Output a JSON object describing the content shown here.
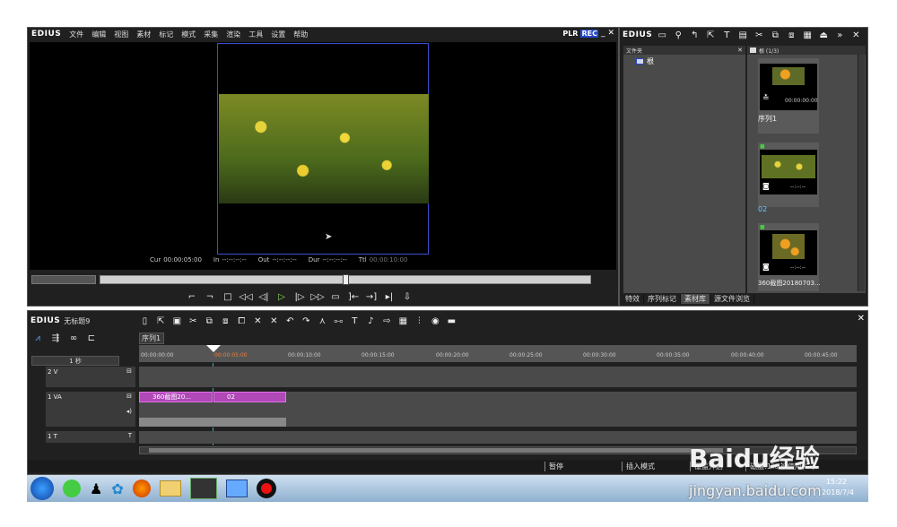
{
  "player": {
    "brand": "EDIUS",
    "menu": [
      "文件",
      "编辑",
      "视图",
      "素材",
      "标记",
      "模式",
      "采集",
      "渲染",
      "工具",
      "设置",
      "帮助"
    ],
    "plr": "PLR",
    "rec": "REC",
    "tc": {
      "cur_label": "Cur",
      "cur": "00:00:05:00",
      "in_label": "In",
      "in": "--:--:--:--",
      "out_label": "Out",
      "out": "--:--:--:--",
      "dur_label": "Dur",
      "dur": "--:--:--:--",
      "ttl_label": "Ttl",
      "ttl": "00:00:10:00"
    }
  },
  "bin": {
    "brand": "EDIUS",
    "folder_header": "文件夹",
    "root_label": "根",
    "clip_header": "根 (1/3)",
    "clips": [
      {
        "label": "序列1",
        "tc": "00:00:00:00"
      },
      {
        "label": "02",
        "tc": "--:--:--"
      },
      {
        "label": "360截图20180703...",
        "tc": "--:--:--"
      }
    ],
    "tabs": [
      "特效",
      "序列标记",
      "素材库",
      "源文件浏览"
    ]
  },
  "timeline": {
    "brand": "EDIUS",
    "project": "无标题9",
    "seq_tab": "序列1",
    "scale": "1 秒",
    "ruler": [
      "00:00:00:00",
      "00:00:05:00",
      "00:00:10:00",
      "00:00:15:00",
      "00:00:20:00",
      "00:00:25:00",
      "00:00:30:00",
      "00:00:35:00",
      "00:00:40:00",
      "00:00:45:00"
    ],
    "tracks": [
      {
        "name": "2 V"
      },
      {
        "name": "1 VA"
      },
      {
        "name": "1 T"
      }
    ],
    "clips": [
      {
        "label": "360截图20..."
      },
      {
        "label": "02"
      }
    ]
  },
  "status": {
    "pause": "暂停",
    "insert": "插入模式",
    "overlay": "覆盖开启",
    "disk": "磁盘:1% 被使用(C:)"
  },
  "taskbar": {
    "time": "15:22",
    "date": "2018/7/4"
  },
  "watermark": {
    "logo": "Baidu经验",
    "url": "jingyan.baidu.com"
  }
}
